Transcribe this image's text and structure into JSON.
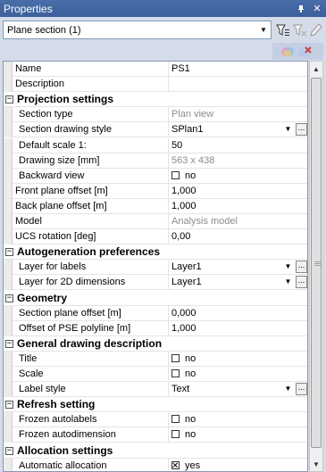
{
  "window": {
    "title": "Properties",
    "pin_glyph": "ᵖ",
    "close_glyph": "✕"
  },
  "toolbar": {
    "selector_value": "Plane section (1)",
    "selector_arrow": "▼"
  },
  "grid": {
    "rows": [
      {
        "kind": "prop",
        "name": "Name",
        "value": "PS1",
        "grey": false
      },
      {
        "kind": "prop",
        "name": "Description",
        "value": "",
        "grey": false
      },
      {
        "kind": "section",
        "name": "Projection settings",
        "toggle": "−"
      },
      {
        "kind": "prop",
        "name": "Section type",
        "value": "Plan view",
        "grey": true,
        "indent": true
      },
      {
        "kind": "prop",
        "name": "Section drawing style",
        "value": "SPlan1",
        "dropdown": true,
        "indent": true
      },
      {
        "kind": "prop",
        "name": "Default scale 1:",
        "value": "50",
        "indent": true
      },
      {
        "kind": "prop",
        "name": "Drawing size [mm]",
        "value": "563 x 438",
        "grey": true,
        "indent": true
      },
      {
        "kind": "prop",
        "name": "Backward view",
        "check": false,
        "value": "no",
        "indent": true
      },
      {
        "kind": "prop",
        "name": "Front plane offset [m]",
        "value": "1,000"
      },
      {
        "kind": "prop",
        "name": "Back plane offset [m]",
        "value": "1,000"
      },
      {
        "kind": "prop",
        "name": "Model",
        "value": "Analysis model",
        "grey": true
      },
      {
        "kind": "prop",
        "name": "UCS rotation [deg]",
        "value": "0,00"
      },
      {
        "kind": "section",
        "name": "Autogeneration preferences",
        "toggle": "−"
      },
      {
        "kind": "prop",
        "name": "Layer for labels",
        "value": "Layer1",
        "dropdown": true,
        "indent": true
      },
      {
        "kind": "prop",
        "name": "Layer for 2D dimensions",
        "value": "Layer1",
        "dropdown": true,
        "indent": true
      },
      {
        "kind": "section",
        "name": "Geometry",
        "toggle": "−"
      },
      {
        "kind": "prop",
        "name": "Section plane offset [m]",
        "value": "0,000",
        "indent": true
      },
      {
        "kind": "prop",
        "name": "Offset of PSE polyline [m]",
        "value": "1,000",
        "indent": true
      },
      {
        "kind": "section",
        "name": "General drawing description",
        "toggle": "−"
      },
      {
        "kind": "prop",
        "name": "Title",
        "check": false,
        "value": "no",
        "indent": true
      },
      {
        "kind": "prop",
        "name": "Scale",
        "check": false,
        "value": "no",
        "indent": true
      },
      {
        "kind": "prop",
        "name": "Label style",
        "value": "Text",
        "dropdown": true,
        "indent": true
      },
      {
        "kind": "section",
        "name": "Refresh setting",
        "toggle": "−"
      },
      {
        "kind": "prop",
        "name": "Frozen autolabels",
        "check": false,
        "value": "no",
        "indent": true
      },
      {
        "kind": "prop",
        "name": "Frozen autodimension",
        "check": false,
        "value": "no",
        "indent": true
      },
      {
        "kind": "section",
        "name": "Allocation settings",
        "toggle": "−"
      },
      {
        "kind": "prop",
        "name": "Automatic allocation",
        "check": true,
        "value": "yes",
        "indent": true
      }
    ],
    "dropdown_arrow": "▼",
    "ellipsis": "..."
  },
  "scrollbar": {
    "up_glyph": "▲",
    "down_glyph": "▼"
  },
  "colors": {
    "title_bar": "#3f64a0",
    "panel_bg": "#d6dbe9",
    "grey_text": "#8c8c8c"
  }
}
